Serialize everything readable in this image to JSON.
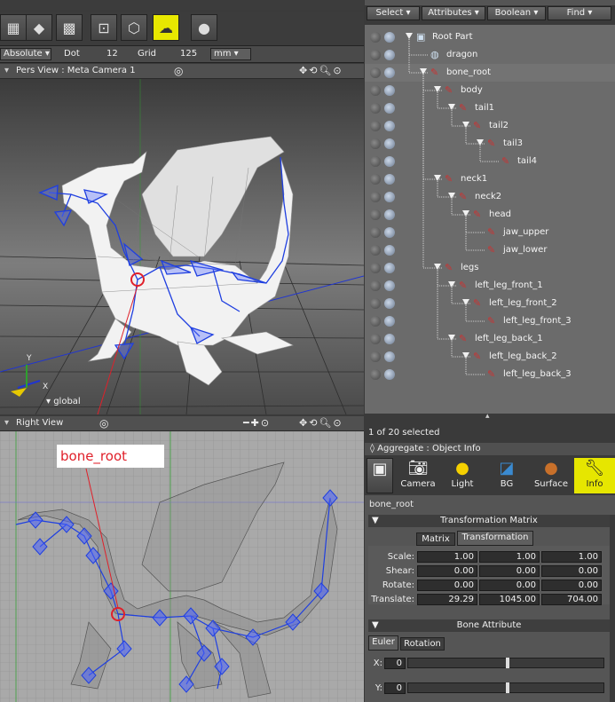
{
  "toolbar": {
    "units": {
      "mode_value": "Absolute",
      "dot_label": "Dot",
      "dot_value": "12",
      "grid_label": "Grid",
      "grid_value": "125",
      "unit_value": "mm"
    }
  },
  "pers_view": {
    "title": "Pers View : Meta Camera 1",
    "axis_x": "X",
    "axis_y": "Y",
    "coord_label": "global"
  },
  "right_view": {
    "title": "Right View",
    "callout": "bone_root"
  },
  "browser": {
    "menu": [
      "Select",
      "Attributes",
      "Boolean",
      "Find"
    ],
    "tree": [
      {
        "label": "Root Part",
        "depth": 0,
        "kind": "part",
        "expanded": true
      },
      {
        "label": "dragon",
        "depth": 1,
        "kind": "mesh",
        "expanded": false
      },
      {
        "label": "bone_root",
        "depth": 1,
        "kind": "bone",
        "expanded": true
      },
      {
        "label": "body",
        "depth": 2,
        "kind": "bone",
        "expanded": true
      },
      {
        "label": "tail1",
        "depth": 3,
        "kind": "bone",
        "expanded": true
      },
      {
        "label": "tail2",
        "depth": 4,
        "kind": "bone",
        "expanded": true
      },
      {
        "label": "tail3",
        "depth": 5,
        "kind": "bone",
        "expanded": true
      },
      {
        "label": "tail4",
        "depth": 6,
        "kind": "bone",
        "expanded": false
      },
      {
        "label": "neck1",
        "depth": 2,
        "kind": "bone",
        "expanded": true
      },
      {
        "label": "neck2",
        "depth": 3,
        "kind": "bone",
        "expanded": true
      },
      {
        "label": "head",
        "depth": 4,
        "kind": "bone",
        "expanded": true
      },
      {
        "label": "jaw_upper",
        "depth": 5,
        "kind": "bone",
        "expanded": false
      },
      {
        "label": "jaw_lower",
        "depth": 5,
        "kind": "bone",
        "expanded": false
      },
      {
        "label": "legs",
        "depth": 2,
        "kind": "bone",
        "expanded": true
      },
      {
        "label": "left_leg_front_1",
        "depth": 3,
        "kind": "bone",
        "expanded": true
      },
      {
        "label": "left_leg_front_2",
        "depth": 4,
        "kind": "bone",
        "expanded": true
      },
      {
        "label": "left_leg_front_3",
        "depth": 5,
        "kind": "bone",
        "expanded": false
      },
      {
        "label": "left_leg_back_1",
        "depth": 3,
        "kind": "bone",
        "expanded": true
      },
      {
        "label": "left_leg_back_2",
        "depth": 4,
        "kind": "bone",
        "expanded": true
      },
      {
        "label": "left_leg_back_3",
        "depth": 5,
        "kind": "bone",
        "expanded": false
      }
    ],
    "status": "1 of 20 selected"
  },
  "info": {
    "header": "Aggregate : Object Info",
    "tabs": [
      "Camera",
      "Light",
      "BG",
      "Surface",
      "Info"
    ],
    "active_tab": "Info",
    "object_name": "bone_root",
    "transform_section": "Transformation Matrix",
    "subtabs": [
      "Matrix",
      "Transformation"
    ],
    "rows": [
      {
        "label": "Scale:",
        "values": [
          "1.00",
          "1.00",
          "1.00"
        ]
      },
      {
        "label": "Shear:",
        "values": [
          "0.00",
          "0.00",
          "0.00"
        ]
      },
      {
        "label": "Rotate:",
        "values": [
          "0.00",
          "0.00",
          "0.00"
        ]
      },
      {
        "label": "Translate:",
        "values": [
          "29.29",
          "1045.00",
          "704.00"
        ]
      }
    ],
    "bone_section": "Bone Attribute",
    "bone_subtabs": [
      "Euler",
      "Rotation"
    ],
    "euler": [
      {
        "label": "X:",
        "value": "0"
      },
      {
        "label": "Y:",
        "value": "0"
      }
    ]
  },
  "colors": {
    "accent_yellow": "#e6e600",
    "bone_blue": "#1f3fe0",
    "highlight_red": "#e0202a"
  }
}
